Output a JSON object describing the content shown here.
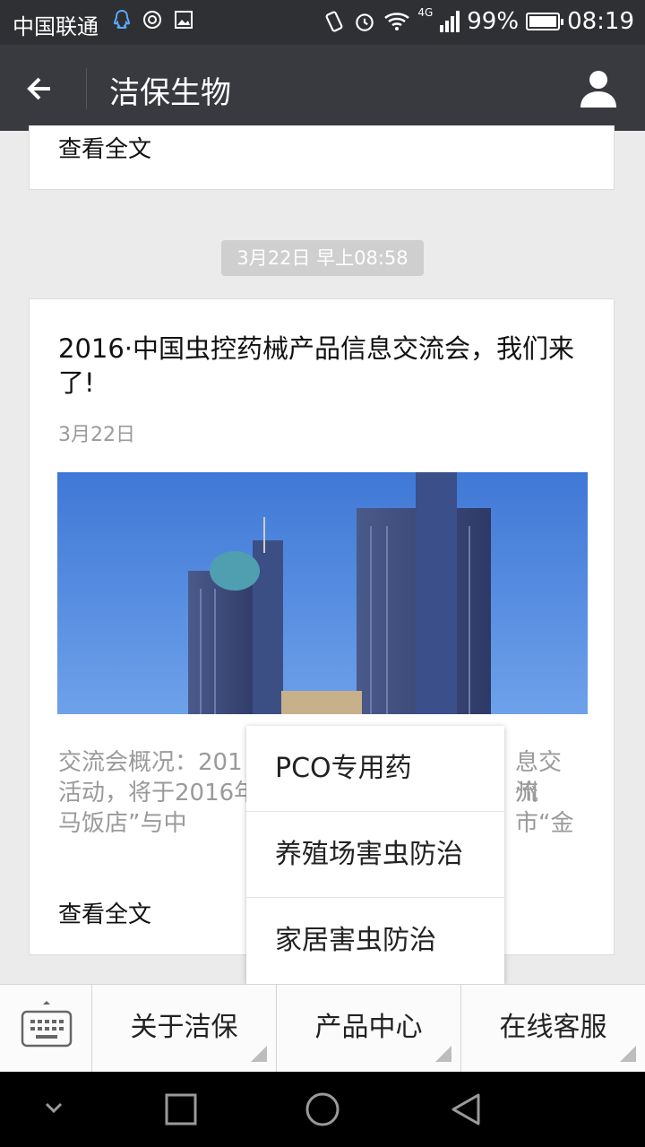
{
  "status_bar": {
    "carrier": "中国联通",
    "network": "4G",
    "battery": "99%",
    "battery_level": 0.99,
    "time": "08:19"
  },
  "nav": {
    "title": "洁保生物"
  },
  "top_card": {
    "read_all": "查看全文"
  },
  "timestamp": "3月22日 早上08:58",
  "article": {
    "title": "2016·中国虫控药械产品信息交流会，我们来了!",
    "date": "3月22日",
    "summary_left": "交流会概况：201",
    "summary_right": "息交流",
    "summary_line2_left": "活动，将于2016年",
    "summary_line2_right": "州市“金",
    "summary_line3": "马饭店”与中",
    "read_all": "查看全文"
  },
  "popup_menu": {
    "items": [
      "PCO专用药",
      "养殖场害虫防治",
      "家居害虫防治"
    ]
  },
  "bottom_menu": {
    "tabs": [
      "关于洁保",
      "产品中心",
      "在线客服"
    ]
  }
}
